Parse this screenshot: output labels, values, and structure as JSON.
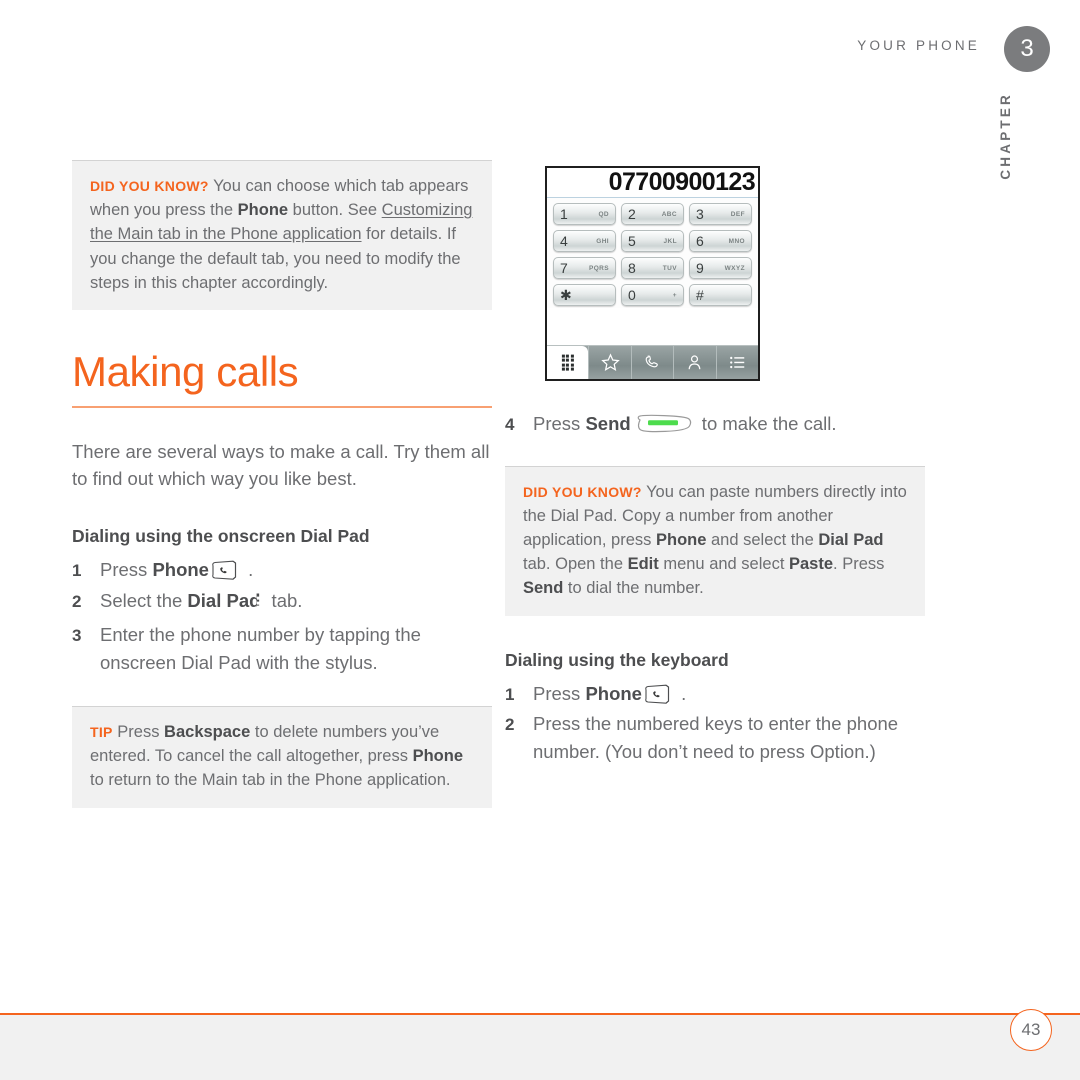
{
  "header": {
    "running_head": "YOUR PHONE",
    "chapter_number": "3",
    "chapter_label": "CHAPTER"
  },
  "left_column": {
    "did_you_know": {
      "lead": "DID YOU KNOW?",
      "text_part1": "You can choose which tab appears when you press the ",
      "bold1": "Phone",
      "text_part2": " button. See ",
      "link": "Customizing the Main tab in the Phone application",
      "text_part3": " for details. If you change the default tab, you need to modify the steps in this chapter accordingly."
    },
    "heading": "Making calls",
    "intro": "There are several ways to make a call. Try them all to find out which way you like best.",
    "subheading": "Dialing using the onscreen Dial Pad",
    "steps": [
      {
        "num": "1",
        "pre": "Press ",
        "bold": "Phone",
        "post": " .",
        "icon": "phone-button-icon"
      },
      {
        "num": "2",
        "pre": "Select the ",
        "bold": "Dial Pad",
        "post": " tab.",
        "icon": "dialpad-tab-icon"
      },
      {
        "num": "3",
        "pre": "Enter the phone number by tapping the onscreen Dial Pad with the stylus.",
        "bold": "",
        "post": "",
        "icon": ""
      }
    ],
    "tip": {
      "lead": "TIP",
      "text_part1": "Press ",
      "bold1": "Backspace",
      "text_part2": " to delete numbers you’ve entered. To cancel the call altogether, press ",
      "bold2": "Phone",
      "text_part3": " to return to the Main tab in the Phone application."
    }
  },
  "right_column": {
    "dialpad_screenshot": {
      "display_number": "07700900123",
      "keys": [
        {
          "digit": "1",
          "letters": "QD"
        },
        {
          "digit": "2",
          "letters": "ABC"
        },
        {
          "digit": "3",
          "letters": "DEF"
        },
        {
          "digit": "4",
          "letters": "GHI"
        },
        {
          "digit": "5",
          "letters": "JKL"
        },
        {
          "digit": "6",
          "letters": "MNO"
        },
        {
          "digit": "7",
          "letters": "PQRS"
        },
        {
          "digit": "8",
          "letters": "TUV"
        },
        {
          "digit": "9",
          "letters": "WXYZ"
        },
        {
          "digit": "✱",
          "letters": ""
        },
        {
          "digit": "0",
          "letters": "+"
        },
        {
          "digit": "#",
          "letters": ""
        }
      ],
      "tabs": [
        "dialpad-tab-icon",
        "star-tab-icon",
        "handset-tab-icon",
        "contact-tab-icon",
        "list-tab-icon"
      ]
    },
    "step4": {
      "num": "4",
      "pre": "Press ",
      "bold": "Send",
      "post": " to make the call.",
      "icon": "send-button-icon"
    },
    "did_you_know": {
      "lead": "DID YOU KNOW?",
      "text_part1": "You can paste numbers directly into the Dial Pad. Copy a number from another application, press ",
      "bold1": "Phone",
      "text_part2": " and select the ",
      "bold2": "Dial Pad",
      "text_part3": " tab. Open the ",
      "bold3": "Edit",
      "text_part4": " menu and select ",
      "bold4": "Paste",
      "text_part5": ". Press ",
      "bold5": "Send",
      "text_part6": " to dial the number."
    },
    "subheading": "Dialing using the keyboard",
    "steps": [
      {
        "num": "1",
        "pre": "Press ",
        "bold": "Phone",
        "post": " .",
        "icon": "phone-button-icon"
      },
      {
        "num": "2",
        "pre": "Press the numbered keys to enter the phone number. (You don’t need to press Option.)",
        "bold": "",
        "post": "",
        "icon": ""
      }
    ]
  },
  "footer": {
    "page_number": "43"
  },
  "colors": {
    "accent": "#f4641e",
    "accent_light": "#f8a072",
    "body_text": "#6d6e71",
    "bold_text": "#4d4e50",
    "callout_bg": "#f1f1f1",
    "chapter_badge_bg": "#7b7c7e",
    "send_green": "#4ddc4d"
  }
}
